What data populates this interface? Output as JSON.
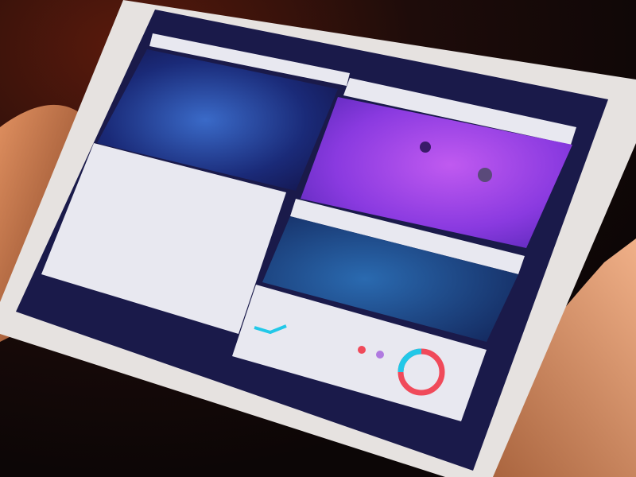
{
  "scene": {
    "subject": "tablet-held-in-hands",
    "colors": {
      "background": "#1a0c0a",
      "skin": "#c8784a",
      "bezel": "#e6e2e0",
      "screen": "#1a1a4a",
      "galaxy_blue": "#1e3a8a",
      "purple_panel": "#8a3ae0",
      "card_white": "#e8e8f0",
      "ring_cyan": "#22c8e8",
      "ring_red": "#f04a5a"
    },
    "icons": [
      "ring-chart-icon",
      "dot-indicator-icon"
    ]
  }
}
